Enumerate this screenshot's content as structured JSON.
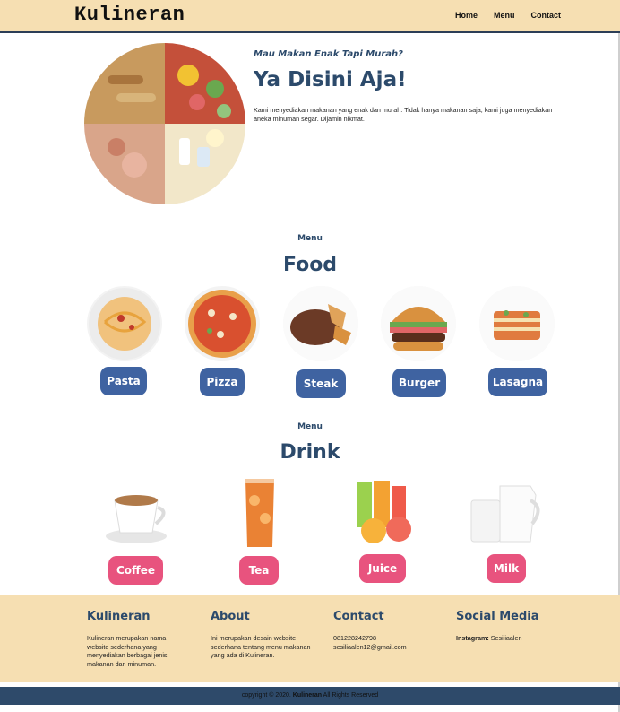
{
  "header": {
    "brand": "Kulineran",
    "nav": [
      "Home",
      "Menu",
      "Contact"
    ]
  },
  "hero": {
    "subtitle": "Mau Makan Enak Tapi Murah?",
    "title": "Ya Disini Aja!",
    "text": "Kami menyediakan makanan yang enak dan murah. Tidak hanya makanan saja, kami juga menyediakan aneka minuman segar. Dijamin nikmat."
  },
  "food": {
    "kicker": "Menu",
    "title": "Food",
    "items": [
      "Pasta",
      "Pizza",
      "Steak",
      "Burger",
      "Lasagna"
    ]
  },
  "drink": {
    "kicker": "Menu",
    "title": "Drink",
    "items": [
      "Coffee",
      "Tea",
      "Juice",
      "Milk"
    ]
  },
  "footer": {
    "about_brand": {
      "title": "Kulineran",
      "text": "Kulineran merupakan nama website sederhana yang menyediakan berbagai jenis makanan dan minuman."
    },
    "about": {
      "title": "About",
      "text": "Ini merupakan desain website sederhana tentang menu makanan yang ada di Kulineran."
    },
    "contact": {
      "title": "Contact",
      "phone": "081228242798",
      "email": "sesiliaalen12@gmail.com"
    },
    "social": {
      "title": "Social Media",
      "label": "Instagram:",
      "value": "Sesiliaalen"
    }
  },
  "copyright": {
    "prefix": "copyright © 2020.",
    "brand": "Kulineran",
    "suffix": "All Rights Reserved"
  },
  "colors": {
    "cream": "#f6dfb2",
    "navy": "#2c4a6b",
    "food_button": "#3f63a1",
    "drink_button": "#e8537e"
  }
}
